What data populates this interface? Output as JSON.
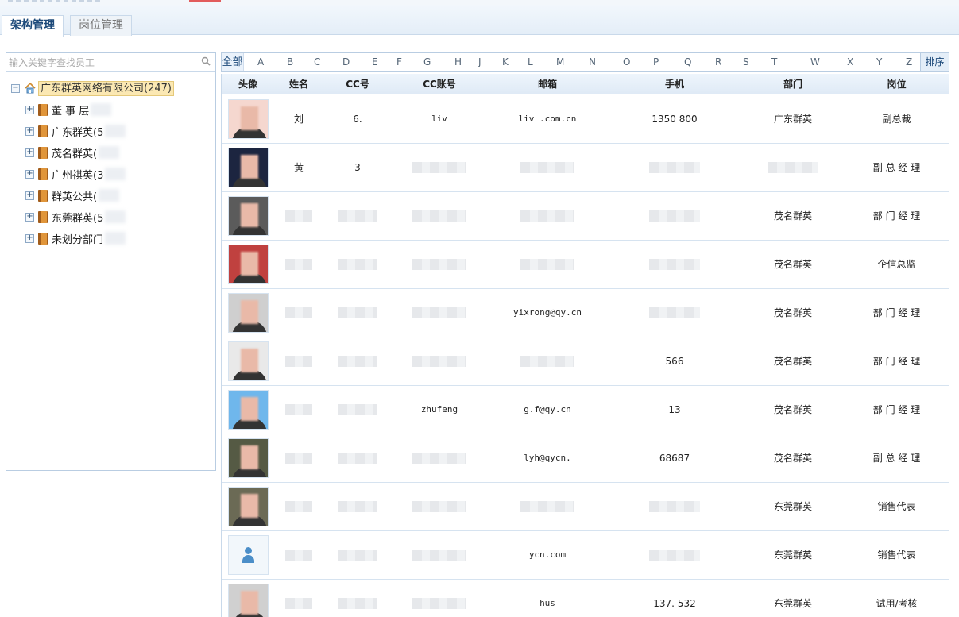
{
  "tabs": [
    {
      "label": "架构管理",
      "active": true
    },
    {
      "label": "岗位管理",
      "active": false
    }
  ],
  "sidebar": {
    "search_placeholder": "输入关键字查找员工",
    "root": {
      "label": "广东群英网络有限公司(247)"
    },
    "items": [
      {
        "label": "董 事 层"
      },
      {
        "label": "广东群英(5"
      },
      {
        "label": "茂名群英("
      },
      {
        "label": "广州祺英(3"
      },
      {
        "label": "群英公共("
      },
      {
        "label": "东莞群英(5"
      },
      {
        "label": "未划分部门"
      }
    ]
  },
  "alpha_filter": {
    "all_label": "全部",
    "letters": [
      "A",
      "B",
      "C",
      "D",
      "E",
      "F",
      "G",
      "H",
      "J",
      "K",
      "L",
      "M",
      "N",
      "O",
      "P",
      "Q",
      "R",
      "S",
      "T",
      "W",
      "X",
      "Y",
      "Z"
    ],
    "sort_label": "排序"
  },
  "table": {
    "columns": [
      "头像",
      "姓名",
      "CC号",
      "CC账号",
      "邮箱",
      "手机",
      "部门",
      "岗位"
    ],
    "rows": [
      {
        "name": "刘",
        "cc": "6.",
        "cc_account": "liv",
        "email": "liv      .com.cn",
        "phone": "1350      800",
        "dept": "广东群英",
        "position": "副总裁"
      },
      {
        "name": "黄",
        "cc": "3",
        "cc_account": "",
        "email": "",
        "phone": "",
        "dept": "",
        "position": "副 总 经 理"
      },
      {
        "name": "",
        "cc": "",
        "cc_account": "",
        "email": "",
        "phone": "",
        "dept": "茂名群英",
        "position": "部 门 经 理"
      },
      {
        "name": "",
        "cc": "",
        "cc_account": "",
        "email": "",
        "phone": "",
        "dept": "茂名群英",
        "position": "企信总监"
      },
      {
        "name": "",
        "cc": "",
        "cc_account": "",
        "email": "yixrong@qy.cn",
        "phone": "",
        "dept": "茂名群英",
        "position": "部 门 经 理"
      },
      {
        "name": "",
        "cc": "",
        "cc_account": "",
        "email": "",
        "phone": "      566",
        "dept": "茂名群英",
        "position": "部 门 经 理"
      },
      {
        "name": "",
        "cc": "",
        "cc_account": "zhufeng",
        "email": "g.f@qy.cn",
        "phone": "13",
        "dept": "茂名群英",
        "position": "部 门 经 理"
      },
      {
        "name": "",
        "cc": "",
        "cc_account": "",
        "email": "lyh@qycn.",
        "phone": "      68687",
        "dept": "茂名群英",
        "position": "副 总 经 理"
      },
      {
        "name": "",
        "cc": "",
        "cc_account": "",
        "email": "",
        "phone": "",
        "dept": "东莞群英",
        "position": "销售代表"
      },
      {
        "name": "",
        "cc": "",
        "cc_account": "",
        "email": "      ycn.com",
        "phone": "",
        "dept": "东莞群英",
        "position": "销售代表"
      },
      {
        "name": "",
        "cc": "",
        "cc_account": "",
        "email": "hus",
        "phone": "137.      532",
        "dept": "东莞群英",
        "position": "试用/考核"
      }
    ]
  },
  "colors": {
    "accent": "#1d4a7a",
    "root_highlight": "#fbe8b3",
    "border": "#b9cde2"
  }
}
